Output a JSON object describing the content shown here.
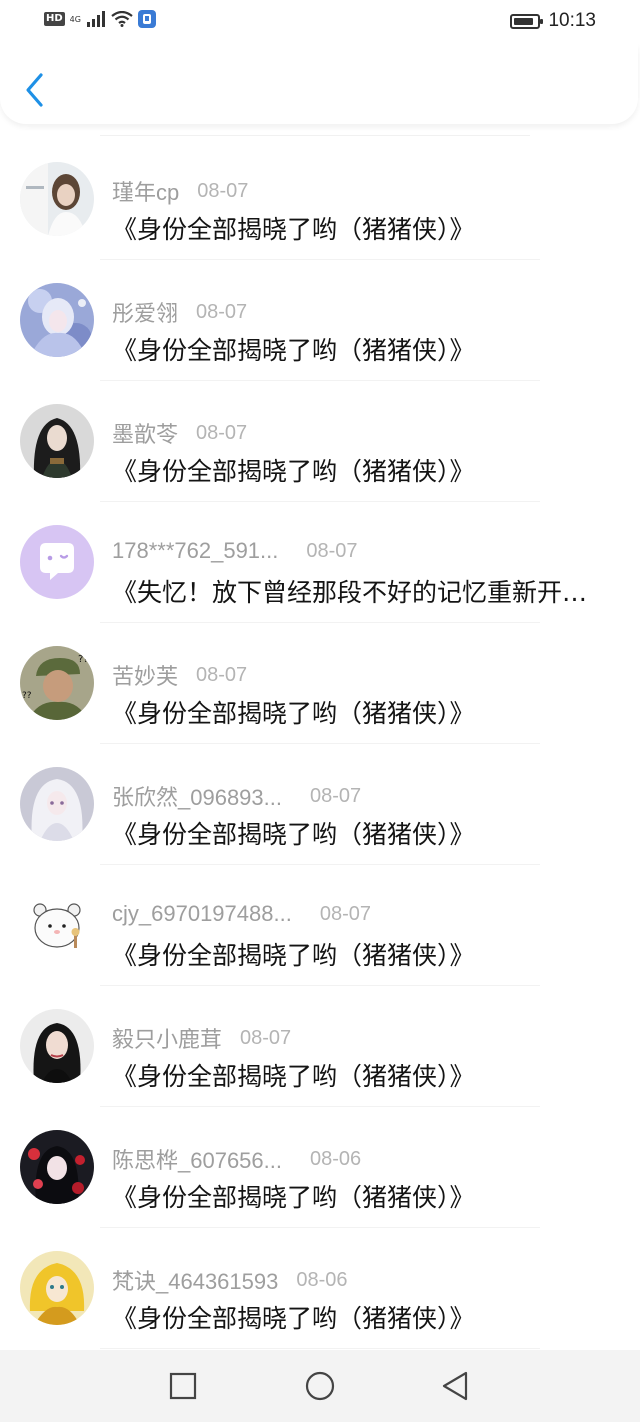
{
  "status_bar": {
    "hd_label": "HD",
    "network_label": "4G",
    "time": "10:13",
    "battery_level": 0.85
  },
  "nav": {
    "back_icon": "chevron-left-icon",
    "accent_color": "#1e90e6"
  },
  "items": [
    {
      "name": "瑾年cp",
      "date": "08-07",
      "title": "《身份全部揭晓了哟（猪猪侠）》",
      "avatar": "avatar-girl-photo"
    },
    {
      "name": "彤爱翎",
      "date": "08-07",
      "title": "《身份全部揭晓了哟（猪猪侠）》",
      "avatar": "avatar-anime-blue"
    },
    {
      "name": "墨歆苓",
      "date": "08-07",
      "title": "《身份全部揭晓了哟（猪猪侠）》",
      "avatar": "avatar-dark-hair-girl"
    },
    {
      "name": "178***762_591...",
      "date": "08-07",
      "title": "《失忆！放下曾经那段不好的记忆重新开始》",
      "avatar": "avatar-default-chat-bubble"
    },
    {
      "name": "苦妙芙",
      "date": "08-07",
      "title": "《身份全部揭晓了哟（猪猪侠）》",
      "avatar": "avatar-soldier-meme"
    },
    {
      "name": "张欣然_096893...",
      "date": "08-07",
      "title": "《身份全部揭晓了哟（猪猪侠）》",
      "avatar": "avatar-white-hair-girl"
    },
    {
      "name": "cjy_6970197488...",
      "date": "08-07",
      "title": "《身份全部揭晓了哟（猪猪侠）》",
      "avatar": "avatar-cartoon-bear"
    },
    {
      "name": "毅只小鹿茸",
      "date": "08-07",
      "title": "《身份全部揭晓了哟（猪猪侠）》",
      "avatar": "avatar-woman-portrait"
    },
    {
      "name": "陈思桦_607656...",
      "date": "08-06",
      "title": "《身份全部揭晓了哟（猪猪侠）》",
      "avatar": "avatar-red-flowers-girl"
    },
    {
      "name": "梵诀_464361593",
      "date": "08-06",
      "title": "《身份全部揭晓了哟（猪猪侠）》",
      "avatar": "avatar-yellow-anime"
    }
  ],
  "system_nav": {
    "recent": "square-icon",
    "home": "circle-icon",
    "back": "triangle-back-icon"
  }
}
